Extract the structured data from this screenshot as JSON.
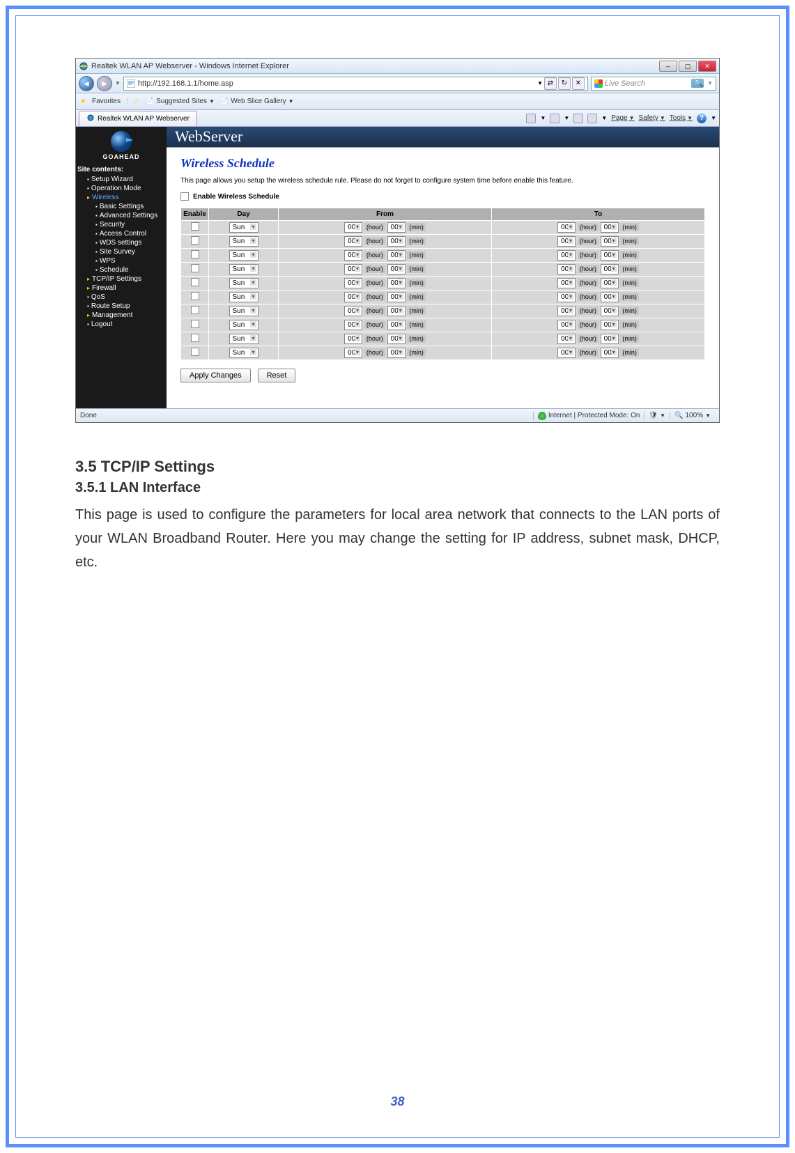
{
  "browser": {
    "window_title": "Realtek WLAN AP Webserver - Windows Internet Explorer",
    "url": "http://192.168.1.1/home.asp",
    "search_placeholder": "Live Search",
    "favorites_label": "Favorites",
    "suggested_sites": "Suggested Sites",
    "web_slice": "Web Slice Gallery",
    "tab_title": "Realtek WLAN AP Webserver",
    "toolbar": {
      "page": "Page",
      "safety": "Safety",
      "tools": "Tools"
    },
    "status_done": "Done",
    "status_mode": "Internet | Protected Mode: On",
    "zoom": "100%"
  },
  "sidebar": {
    "logo": "GOAHEAD",
    "header": "Site contents:",
    "items": [
      {
        "label": "Setup Wizard",
        "lvl": 1
      },
      {
        "label": "Operation Mode",
        "lvl": 1
      },
      {
        "label": "Wireless",
        "lvl": 1,
        "folder": true,
        "active": true
      },
      {
        "label": "Basic Settings",
        "lvl": 2
      },
      {
        "label": "Advanced Settings",
        "lvl": 2
      },
      {
        "label": "Security",
        "lvl": 2
      },
      {
        "label": "Access Control",
        "lvl": 2
      },
      {
        "label": "WDS settings",
        "lvl": 2
      },
      {
        "label": "Site Survey",
        "lvl": 2
      },
      {
        "label": "WPS",
        "lvl": 2
      },
      {
        "label": "Schedule",
        "lvl": 2
      },
      {
        "label": "TCP/IP Settings",
        "lvl": 1,
        "folder": true
      },
      {
        "label": "Firewall",
        "lvl": 1,
        "folder": true
      },
      {
        "label": "QoS",
        "lvl": 1
      },
      {
        "label": "Route Setup",
        "lvl": 1
      },
      {
        "label": "Management",
        "lvl": 1,
        "folder": true
      },
      {
        "label": "Logout",
        "lvl": 1
      }
    ]
  },
  "page": {
    "banner": "WebServer",
    "title": "Wireless Schedule",
    "description": "This page allows you setup the wireless schedule rule. Please do not forget to configure system time before enable this feature.",
    "enable_label": "Enable Wireless Schedule",
    "headers": {
      "enable": "Enable",
      "day": "Day",
      "from": "From",
      "to": "To"
    },
    "row_defaults": {
      "day": "Sun",
      "hour": "00",
      "min": "00",
      "hour_lbl": "(hour)",
      "min_lbl": "(min)"
    },
    "row_count": 10,
    "buttons": {
      "apply": "Apply Changes",
      "reset": "Reset"
    }
  },
  "doc": {
    "h1": "3.5   TCP/IP Settings",
    "h2": "3.5.1   LAN Interface",
    "p": "This page is used to configure the parameters for local area network that connects to the LAN ports of your WLAN Broadband Router. Here you may change the setting for IP address, subnet mask, DHCP, etc.",
    "page_num": "38"
  }
}
